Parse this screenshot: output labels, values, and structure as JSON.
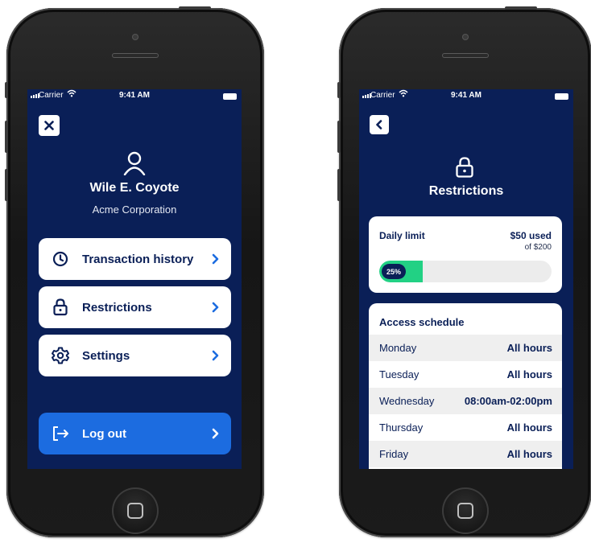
{
  "status_bar": {
    "carrier": "Carrier",
    "time": "9:41 AM"
  },
  "profile_screen": {
    "close_icon": "close-icon",
    "user_name": "Wile E. Coyote",
    "company": "Acme Corporation",
    "menu": [
      {
        "label": "Transaction history",
        "icon": "clock-icon"
      },
      {
        "label": "Restrictions",
        "icon": "lock-icon"
      },
      {
        "label": "Settings",
        "icon": "gear-icon"
      }
    ],
    "logout": {
      "label": "Log out",
      "icon": "logout-icon"
    }
  },
  "restrictions_screen": {
    "back_icon": "chevron-left-icon",
    "title": "Restrictions",
    "daily_limit": {
      "label": "Daily limit",
      "used": "$50 used",
      "of_total": "of $200",
      "percent_label": "25%",
      "progress_fraction": 0.25
    },
    "schedule": {
      "title": "Access schedule",
      "rows": [
        {
          "day": "Monday",
          "hours": "All hours"
        },
        {
          "day": "Tuesday",
          "hours": "All hours"
        },
        {
          "day": "Wednesday",
          "hours": "08:00am-02:00pm"
        },
        {
          "day": "Thursday",
          "hours": "All hours"
        },
        {
          "day": "Friday",
          "hours": "All hours"
        }
      ]
    }
  },
  "colors": {
    "screen_bg": "#0a1f57",
    "accent_blue": "#1c6ce0",
    "progress_green": "#22d184",
    "card_bg": "#ffffff"
  }
}
